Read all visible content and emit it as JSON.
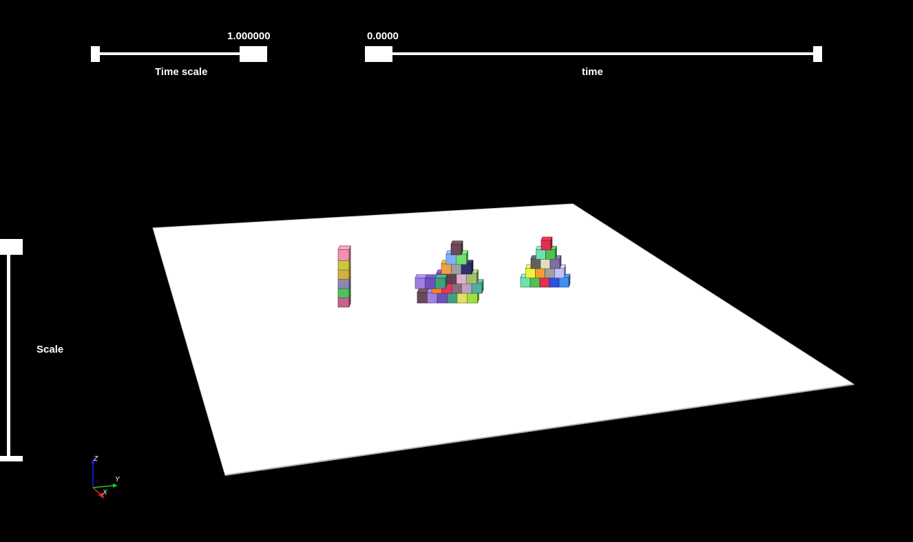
{
  "time_scale_slider": {
    "label": "Time scale",
    "value_text": "1.000000",
    "value": 1.0,
    "position_fraction": 0.92
  },
  "time_slider": {
    "label": "time",
    "value_text": "0.0000",
    "value": 0.0,
    "position_fraction": 0.0
  },
  "scale_slider": {
    "label": "Scale",
    "position_fraction": 1.0
  },
  "axes": {
    "z_label": "Z",
    "y_label": "Y",
    "x_label": "X",
    "z_color": "#1a1aff",
    "y_color": "#22cc22",
    "x_color": "#ff2222"
  },
  "scene": {
    "ground_color": "#ffffff",
    "background_color": "#000000",
    "stacks": [
      {
        "name": "column",
        "colors": [
          "#f28fb0",
          "#c8c840",
          "#d4b040",
          "#8a8ab0",
          "#50c060",
          "#c86090"
        ]
      },
      {
        "name": "pyramid-left",
        "colors": [
          "#6a4a5a",
          "#a080e0",
          "#7050c0",
          "#40a080",
          "#e0e060",
          "#a0e040",
          "#f08030",
          "#f03060",
          "#8a6a7a",
          "#c0a0c0",
          "#50b0a0",
          "#a040c0",
          "#604050",
          "#e0b0d0",
          "#a0c070",
          "#f0a040",
          "#a0a0a0",
          "#303070",
          "#80b0ff",
          "#70e070"
        ]
      },
      {
        "name": "pyramid-right",
        "colors": [
          "#70e0b0",
          "#50c050",
          "#e03050",
          "#3050e0",
          "#4090f0",
          "#f0f040",
          "#f0a030",
          "#a0a0a0",
          "#c0c0ff",
          "#606060",
          "#e0e0c0",
          "#8070a0"
        ]
      }
    ]
  }
}
